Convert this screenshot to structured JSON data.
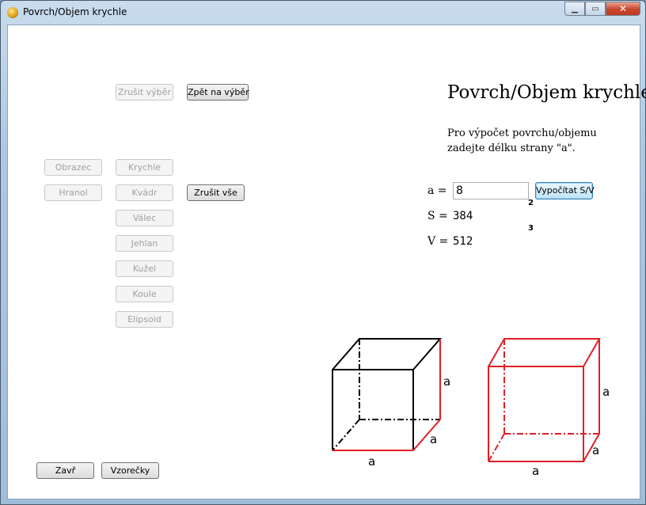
{
  "window": {
    "title": "Povrch/Objem krychle"
  },
  "buttons": {
    "zrusit_vyber": "Zrušit výběr",
    "zpet_na_vyber": "Zpět na výběr",
    "obrazec": "Obrazec",
    "hranol": "Hranol",
    "krychle": "Krychle",
    "kvadr": "Kvádr",
    "valec": "Válec",
    "jehlan": "Jehlan",
    "kuzel": "Kužel",
    "koule": "Koule",
    "elipsoid": "Elipsoid",
    "zrusit_vse": "Zrušit vše",
    "vypocitat": "Vypočítat S/V",
    "zavri": "Zavř",
    "vzorecky": "Vzorečky"
  },
  "calc": {
    "heading": "Povrch/Objem krychle",
    "instructions": "Pro výpočet povrchu/objemu zadejte délku strany \"a\".",
    "a_label": "a =",
    "a_value": "8",
    "s_label": "S =",
    "s_value": "384",
    "s_exp": "2",
    "v_label": "V =",
    "v_value": "512",
    "v_exp": "3"
  },
  "diagram": {
    "edge_label": "a",
    "colors": {
      "black": "#000000",
      "red": "#e31e24"
    }
  }
}
